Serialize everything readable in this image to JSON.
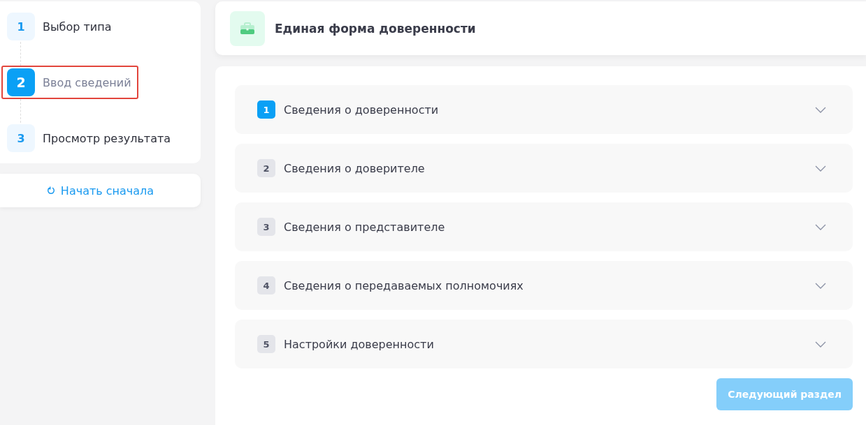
{
  "steps": [
    {
      "number": "1",
      "label": "Выбор типа",
      "selected": false,
      "highlighted": false
    },
    {
      "number": "2",
      "label": "Ввод сведений",
      "selected": true,
      "highlighted": true
    },
    {
      "number": "3",
      "label": "Просмотр результата",
      "selected": false,
      "highlighted": false
    }
  ],
  "restart_button": "Начать сначала",
  "header": {
    "title": "Единая форма доверенности"
  },
  "sections": [
    {
      "number": "1",
      "title": "Сведения о доверенности",
      "selected": true
    },
    {
      "number": "2",
      "title": "Сведения о доверителе",
      "selected": false
    },
    {
      "number": "3",
      "title": "Сведения о представителе",
      "selected": false
    },
    {
      "number": "4",
      "title": "Сведения о передаваемых полномочиях",
      "selected": false
    },
    {
      "number": "5",
      "title": "Настройки доверенности",
      "selected": false
    }
  ],
  "next_button": {
    "label": "Следующий раздел",
    "disabled": true
  }
}
